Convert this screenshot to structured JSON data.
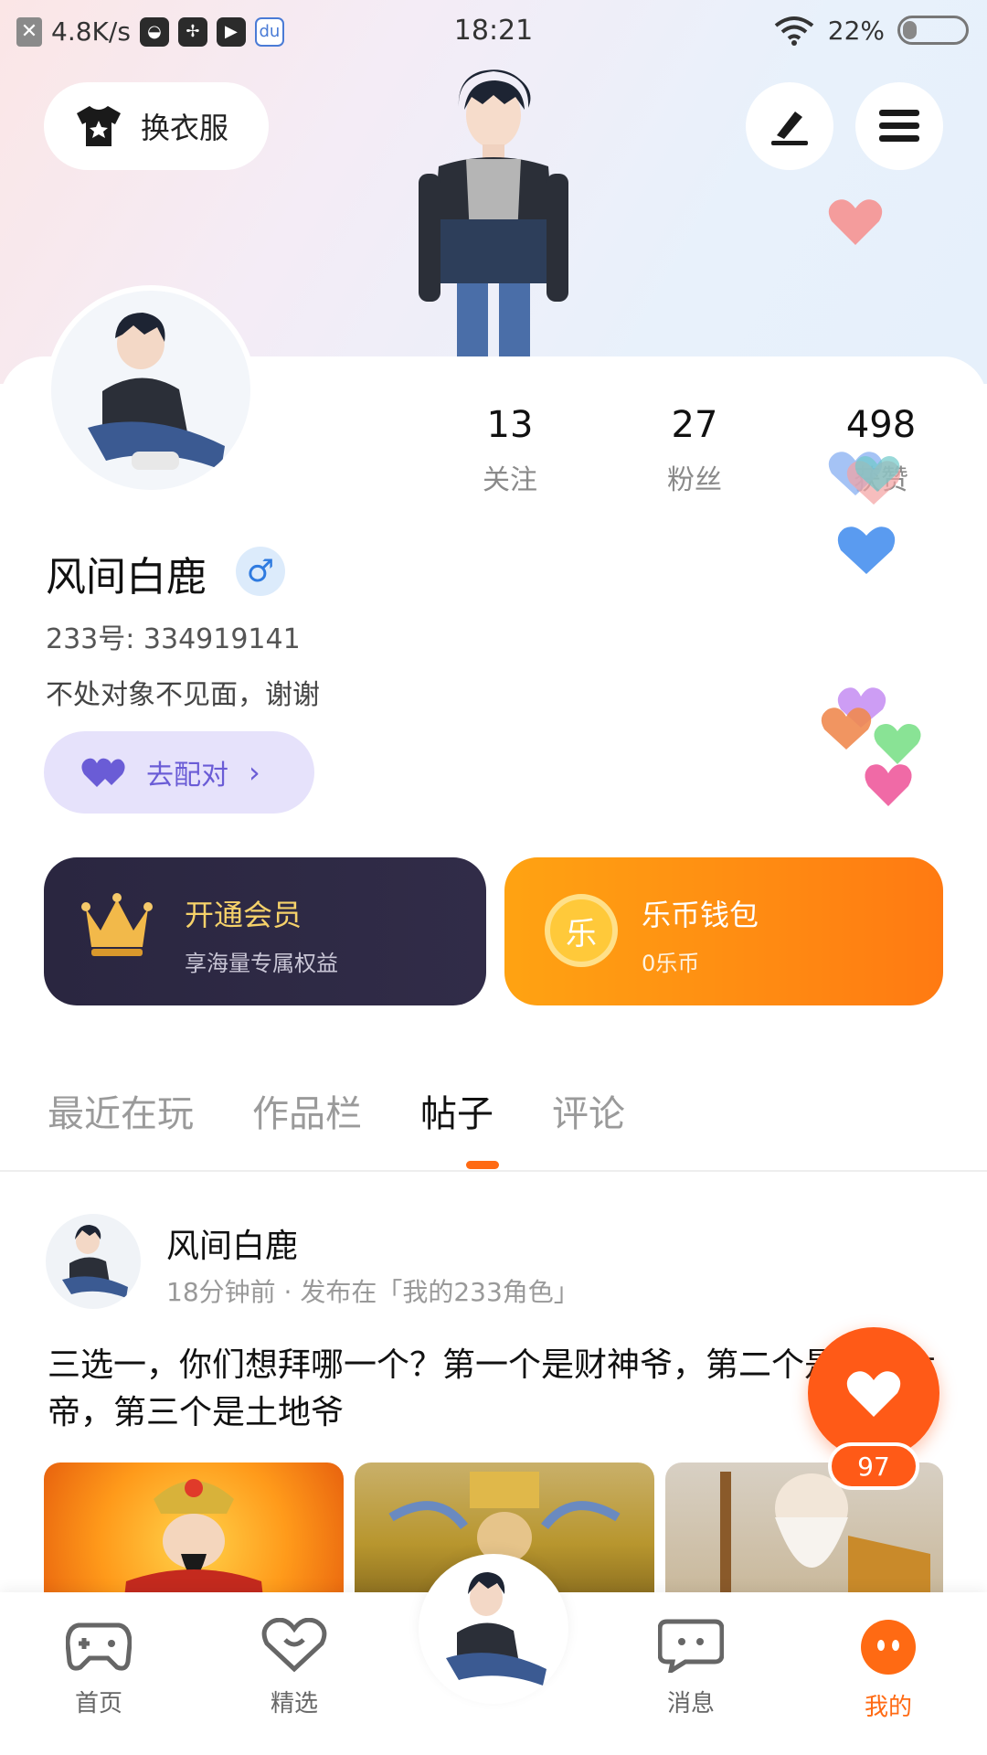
{
  "status_bar": {
    "speed": "4.8K/s",
    "time": "18:21",
    "battery": "22%",
    "battery_level": 0.22
  },
  "header": {
    "outfit_label": "换衣服"
  },
  "profile": {
    "stats": [
      {
        "num": "13",
        "label": "关注"
      },
      {
        "num": "27",
        "label": "粉丝"
      },
      {
        "num": "498",
        "label": "获赞"
      }
    ],
    "name": "风间白鹿",
    "gender_symbol": "♂",
    "uid": "233号: 334919141",
    "bio": "不处对象不见面，谢谢",
    "match_label": "去配对"
  },
  "vip": {
    "title": "开通会员",
    "subtitle": "享海量专属权益"
  },
  "wallet": {
    "title": "乐币钱包",
    "subtitle": "0乐币",
    "coin_char": "乐"
  },
  "tabs": [
    {
      "label": "最近在玩",
      "active": false
    },
    {
      "label": "作品栏",
      "active": false
    },
    {
      "label": "帖子",
      "active": true
    },
    {
      "label": "评论",
      "active": false
    }
  ],
  "post": {
    "author": "风间白鹿",
    "meta": "18分钟前 · 发布在「我的233角色」",
    "text": "三选一，你们想拜哪一个？第一个是财神爷，第二个是玉皇大帝，第三个是土地爷",
    "like_count": "97"
  },
  "bottom_nav": [
    {
      "label": "首页",
      "active": false
    },
    {
      "label": "精选",
      "active": false
    },
    {
      "label": "消息",
      "active": false
    },
    {
      "label": "我的",
      "active": true
    }
  ],
  "colors": {
    "accent": "#ff6a13",
    "vip_bg": "#2a2640",
    "wallet_bg": "#ff8a12",
    "match_bg": "#e6e2fb"
  }
}
